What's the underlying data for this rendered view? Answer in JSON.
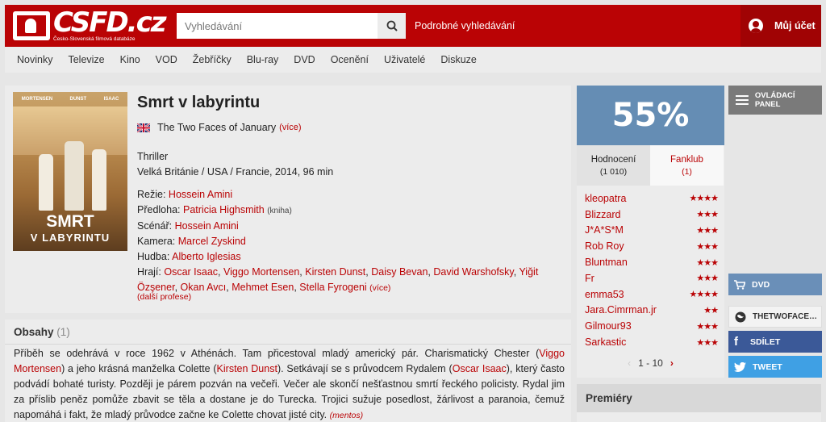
{
  "header": {
    "logo_text": "CSFD.cz",
    "logo_tagline": "Česko-Slovenská filmová databáze",
    "search_placeholder": "Vyhledávání",
    "advanced_search": "Podrobné vyhledávání",
    "account": "Můj účet"
  },
  "nav": [
    "Novinky",
    "Televize",
    "Kino",
    "VOD",
    "Žebříčky",
    "Blu-ray",
    "DVD",
    "Ocenění",
    "Uživatelé",
    "Diskuze"
  ],
  "film": {
    "title": "Smrt v labyrintu",
    "alt_title": "The Two Faces of January",
    "alt_more": "(více)",
    "genre": "Thriller",
    "origin": "Velká Británie / USA / Francie, 2014, 96 min",
    "poster": {
      "names": [
        "MORTENSEN",
        "DUNST",
        "ISAAC"
      ],
      "title_line1": "SMRT",
      "title_line2": "V LABYRINTU"
    },
    "creators": {
      "director_label": "Režie:",
      "director": "Hossein Amini",
      "source_label": "Předloha:",
      "source": "Patricia Highsmith",
      "source_note": "(kniha)",
      "script_label": "Scénář:",
      "script": "Hossein Amini",
      "camera_label": "Kamera:",
      "camera": "Marcel Zyskind",
      "music_label": "Hudba:",
      "music": "Alberto Iglesias",
      "cast_label": "Hrají:",
      "cast": [
        "Oscar Isaac",
        "Viggo Mortensen",
        "Kirsten Dunst",
        "Daisy Bevan",
        "David Warshofsky",
        "Yiğit Özşener",
        "Okan Avcı",
        "Mehmet Esen",
        "Stella Fyrogeni"
      ],
      "cast_more": "(více)"
    },
    "more_professions": "(další profese)"
  },
  "plot": {
    "heading": "Obsahy",
    "count": "(1)",
    "t1": "Příběh se odehrává v roce 1962 v Athénách. Tam přicestoval mladý americký pár. Charismatický Chester (",
    "l1": "Viggo Mortensen",
    "t2": ") a jeho krásná manželka Colette (",
    "l2": "Kirsten Dunst",
    "t3": "). Setkávají se s průvodcem Rydalem (",
    "l3": "Oscar Isaac",
    "t4": "), který často podvádí bohaté turisty. Později je párem pozván na večeři. Večer ale skončí nešťastnou smrtí řeckého policisty. Rydal jim za příslib peněz pomůže zbavit se těla a dostane je do Turecka. Trojici sužuje posedlost, žárlivost a paranoia, čemuž napomáhá i fakt, že mladý průvodce začne ke Colette chovat jisté city.",
    "source": "(mentos)"
  },
  "rating": {
    "percent": "55%",
    "tab_ratings": "Hodnocení",
    "tab_ratings_count": "(1 010)",
    "tab_fanclub": "Fanklub",
    "tab_fanclub_count": "(1)",
    "users": [
      {
        "name": "kleopatra",
        "stars": "★★★★"
      },
      {
        "name": "Blizzard",
        "stars": "★★★"
      },
      {
        "name": "J*A*S*M",
        "stars": "★★★"
      },
      {
        "name": "Rob Roy",
        "stars": "★★★"
      },
      {
        "name": "Bluntman",
        "stars": "★★★"
      },
      {
        "name": "Fr",
        "stars": "★★★"
      },
      {
        "name": "emma53",
        "stars": "★★★★"
      },
      {
        "name": "Jara.Cimrman.jr",
        "stars": "★★"
      },
      {
        "name": "Gilmour93",
        "stars": "★★★"
      },
      {
        "name": "Sarkastic",
        "stars": "★★★"
      }
    ],
    "pager": "1 - 10",
    "pager_prev": "‹",
    "pager_next": "›"
  },
  "sidebar": {
    "control_panel": "OVLÁDACÍ PANEL",
    "dvd": "DVD",
    "website": "THETWOFACE…",
    "share": "SDÍLET",
    "tweet": "TWEET"
  },
  "premieres": "Premiéry"
}
